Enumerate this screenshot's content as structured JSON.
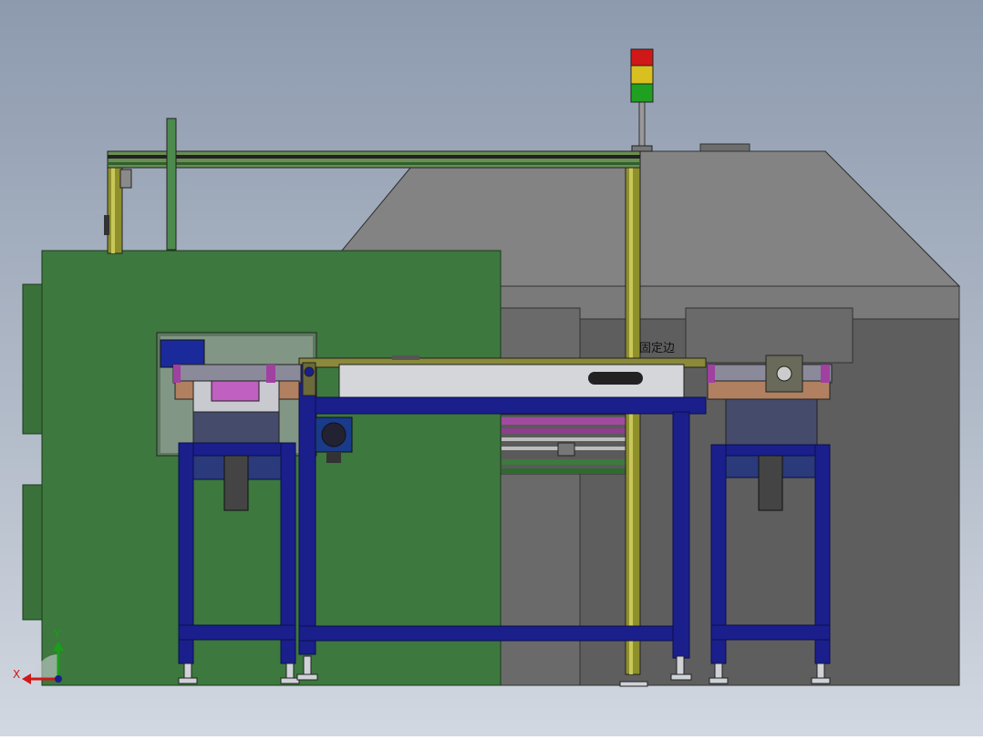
{
  "annotations": {
    "fixed_edge_label": "固定边"
  },
  "triad": {
    "x_label": "X",
    "y_label": "Y"
  },
  "colors": {
    "background_top": "#8d9aae",
    "background_bottom": "#d2d8e1",
    "machine_green": "#3c773d",
    "machine_grey": "#737373",
    "machine_grey_dark": "#5c5c5c",
    "frame_blue": "#1a1f8c",
    "frame_yellow": "#8f8f2c",
    "light_red": "#d01818",
    "light_yellow": "#d8c020",
    "light_green": "#20a020",
    "axis_y": "#18a018",
    "axis_x": "#d01818"
  },
  "icons": {
    "signal_tower": "three-light-signal-tower-icon",
    "motor": "motor-icon",
    "coordinate_triad": "xyz-triad-icon"
  }
}
